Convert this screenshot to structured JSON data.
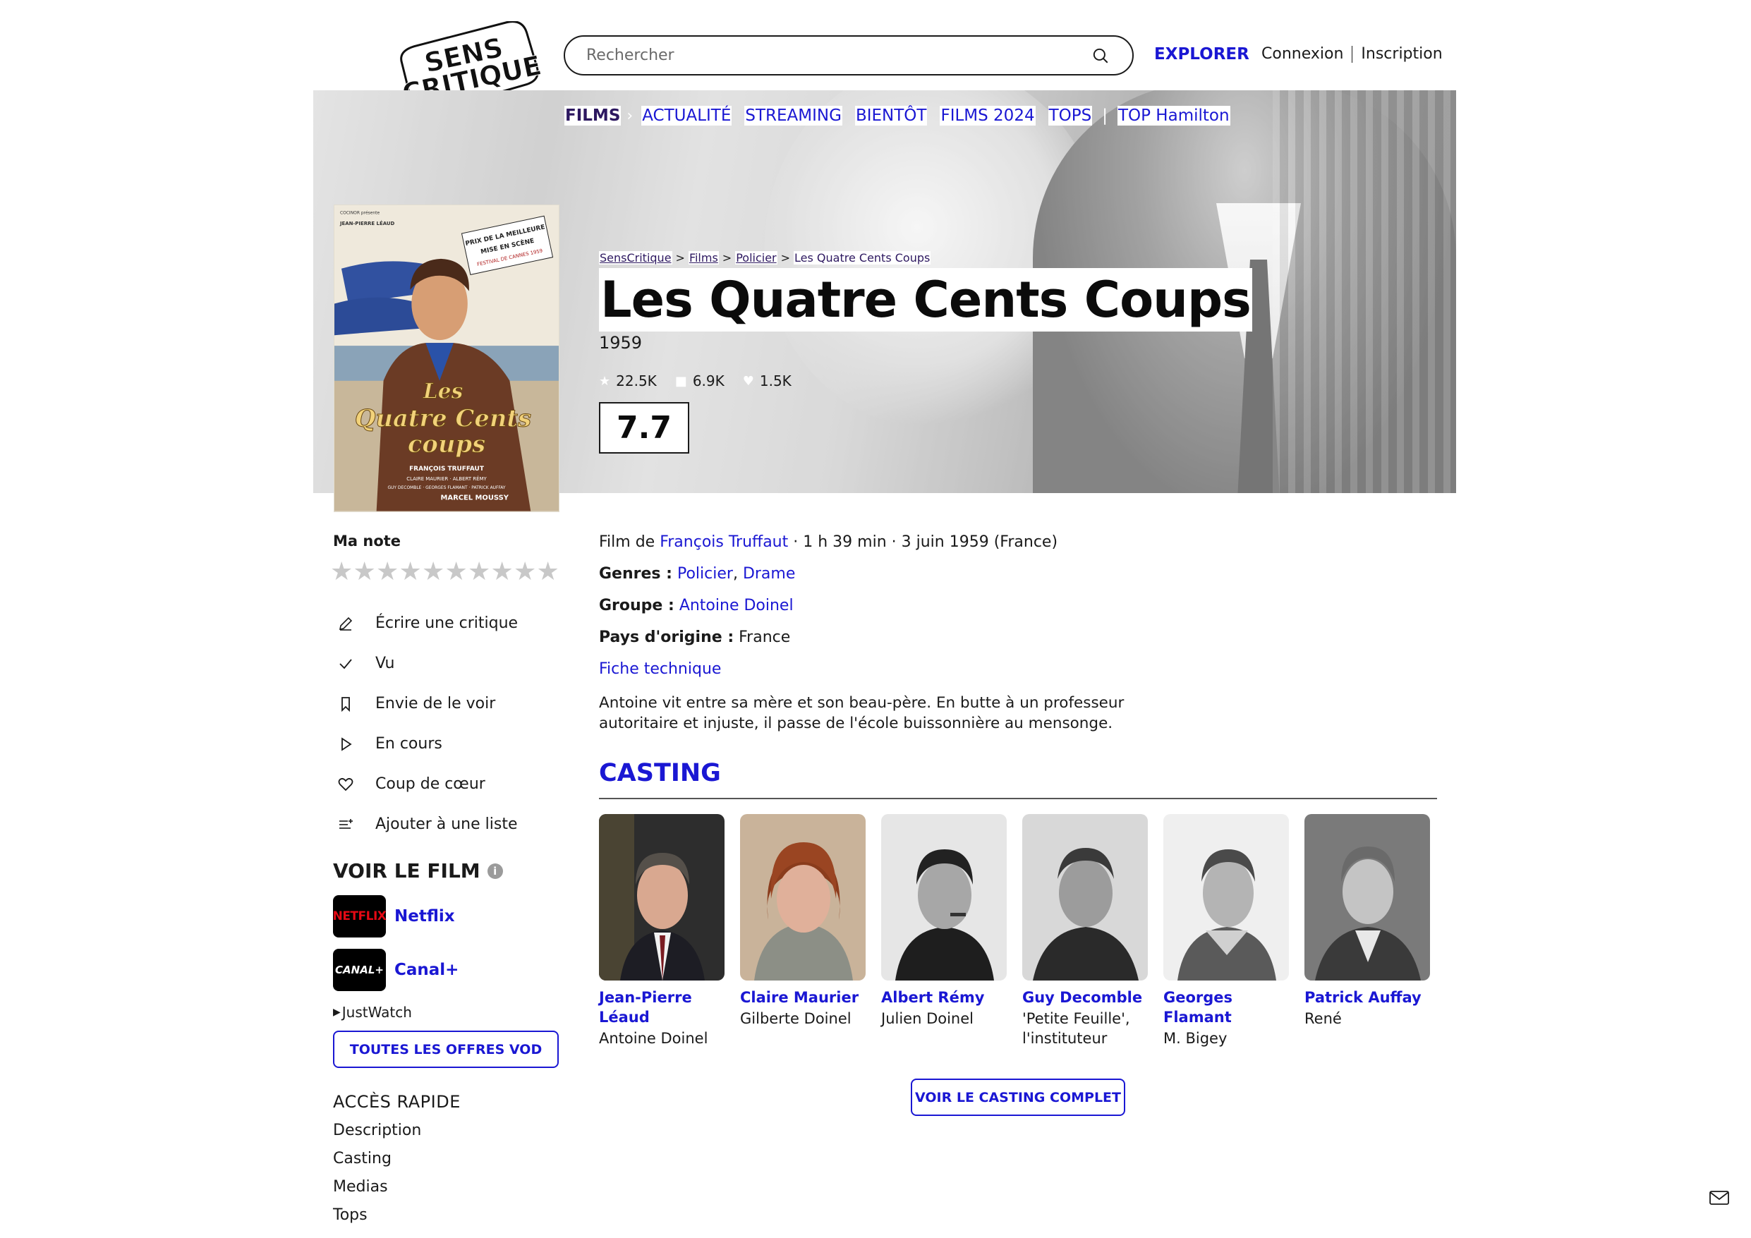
{
  "header": {
    "logo_text_line1": "SENS",
    "logo_text_line2": "CRITIQUE",
    "search_placeholder": "Rechercher",
    "explore_label": "EXPLORER",
    "login_label": "Connexion",
    "signup_label": "Inscription"
  },
  "nav": {
    "films": "FILMS",
    "items": [
      "ACTUALITÉ",
      "STREAMING",
      "BIENTÔT",
      "FILMS 2024",
      "TOPS"
    ],
    "top_hamilton": "TOP Hamilton"
  },
  "breadcrumb": [
    "SensCritique",
    "Films",
    "Policier",
    "Les Quatre Cents Coups"
  ],
  "film": {
    "title": "Les Quatre Cents Coups",
    "year": "1959",
    "stats": [
      "22.5K",
      "6.9K",
      "1.5K"
    ],
    "rating": "7.7",
    "director_prefix": "Film de",
    "director": "François Truffaut",
    "details": "· 1 h 39 min · 3 juin 1959 (France)",
    "genres_label": "Genres :",
    "genres": [
      "Policier",
      "Drame"
    ],
    "group_label": "Groupe :",
    "group": "Antoine Doinel",
    "country_label": "Pays d'origine :",
    "country": "France",
    "tech_sheet": "Fiche technique",
    "synopsis": "Antoine vit entre sa mère et son beau-père. En butte à un professeur autoritaire et injuste, il passe de l'école buissonnière au mensonge."
  },
  "poster": {
    "top_line": "COCINOR présente",
    "actor": "JEAN-PIERRE LÉAUD",
    "prize": [
      "PRIX DE LA MEILLEURE",
      "MISE EN SCÈNE",
      "FESTIVAL DE CANNES 1959"
    ],
    "title_lines": [
      "Les",
      "Quatre Cents",
      "coups"
    ],
    "credit": "FRANÇOIS TRUFFAUT",
    "cast_line1": "CLAIRE MAURIER · ALBERT RÉMY",
    "cast_line2": "GUY DECOMBLE · GEORGES FLAMANT · PATRICK AUFFAY",
    "music": "MARCEL MOUSSY"
  },
  "my_rating": {
    "label": "Ma note",
    "star_count": 10
  },
  "actions": [
    {
      "icon": "pencil-icon",
      "label": "Écrire une critique"
    },
    {
      "icon": "check-icon",
      "label": "Vu"
    },
    {
      "icon": "bookmark-icon",
      "label": "Envie de le voir"
    },
    {
      "icon": "play-icon",
      "label": "En cours"
    },
    {
      "icon": "heart-icon",
      "label": "Coup de cœur"
    },
    {
      "icon": "add-list-icon",
      "label": "Ajouter à une liste"
    }
  ],
  "watch": {
    "title": "VOIR LE FILM",
    "providers": [
      {
        "logo": "NETFLIX",
        "name": "Netflix"
      },
      {
        "logo": "CANAL+",
        "name": "Canal+"
      }
    ],
    "justwatch": "JustWatch",
    "vod_button": "TOUTES LES OFFRES VOD"
  },
  "quick_access": {
    "title": "ACCÈS RAPIDE",
    "links": [
      "Description",
      "Casting",
      "Medias",
      "Tops"
    ]
  },
  "casting": {
    "title": "CASTING",
    "members": [
      {
        "name": "Jean-Pierre Léaud",
        "role": "Antoine Doinel",
        "photo": "color"
      },
      {
        "name": "Claire Maurier",
        "role": "Gilberte Doinel",
        "photo": "color"
      },
      {
        "name": "Albert Rémy",
        "role": "Julien Doinel",
        "photo": "bw"
      },
      {
        "name": "Guy Decomble",
        "role": "'Petite Feuille', l'instituteur",
        "photo": "bw"
      },
      {
        "name": "Georges Flamant",
        "role": "M. Bigey",
        "photo": "bw"
      },
      {
        "name": "Patrick Auffay",
        "role": "René",
        "photo": "bw"
      }
    ],
    "full_button": "VOIR LE CASTING COMPLET"
  },
  "colors": {
    "accent": "#1a17d3",
    "nav_active": "#2d1860",
    "text": "#1a1a1a",
    "netflix_red": "#e50914"
  }
}
